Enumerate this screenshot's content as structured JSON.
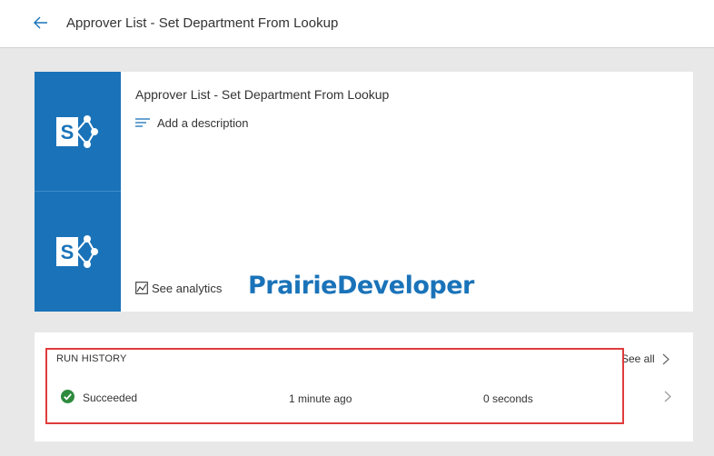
{
  "header": {
    "title": "Approver List - Set Department From Lookup"
  },
  "flow": {
    "title": "Approver List - Set Department From Lookup",
    "add_description_label": "Add a description",
    "see_analytics_label": "See analytics",
    "watermark": "PrairieDeveloper"
  },
  "run_history": {
    "heading": "RUN HISTORY",
    "see_all_label": "See all",
    "runs": [
      {
        "status": "Succeeded",
        "started": "1 minute ago",
        "duration": "0 seconds"
      }
    ]
  },
  "colors": {
    "accent_blue": "#1a73b9",
    "success_green": "#2e8b3e",
    "highlight_red": "#e03c3c"
  },
  "icons": {
    "back": "back-arrow-icon",
    "connector": "sharepoint-icon",
    "description": "description-lines-icon",
    "analytics": "analytics-chart-icon",
    "status": "success-check-icon",
    "chevron": "chevron-right-icon"
  }
}
